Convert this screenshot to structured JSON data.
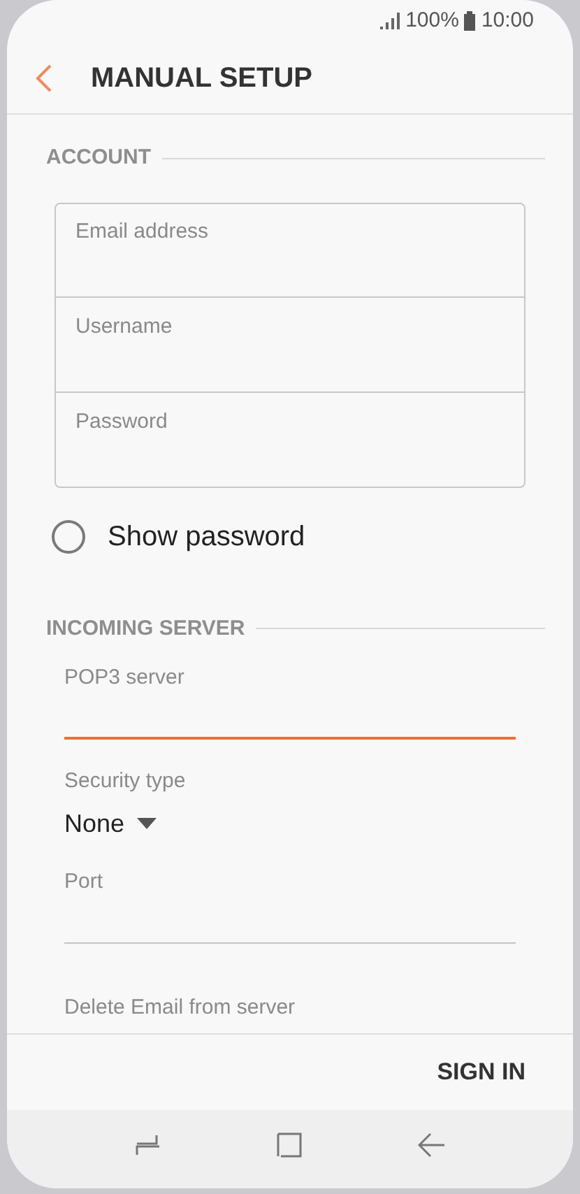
{
  "status_bar": {
    "battery": "100%",
    "time": "10:00"
  },
  "header": {
    "title": "MANUAL SETUP"
  },
  "account": {
    "heading": "ACCOUNT",
    "fields": [
      {
        "placeholder": "Email address"
      },
      {
        "placeholder": "Username"
      },
      {
        "placeholder": "Password"
      }
    ],
    "show_password": {
      "label": "Show password",
      "checked": false
    }
  },
  "incoming_server": {
    "heading": "INCOMING SERVER",
    "fields": [
      {
        "kind": "text",
        "label": "POP3 server",
        "focused": true
      },
      {
        "kind": "select",
        "label": "Security type",
        "value": "None"
      },
      {
        "kind": "text",
        "label": "Port",
        "focused": false
      },
      {
        "kind": "label",
        "label": "Delete Email from server"
      }
    ]
  },
  "footer": {
    "button": "SIGN IN"
  }
}
